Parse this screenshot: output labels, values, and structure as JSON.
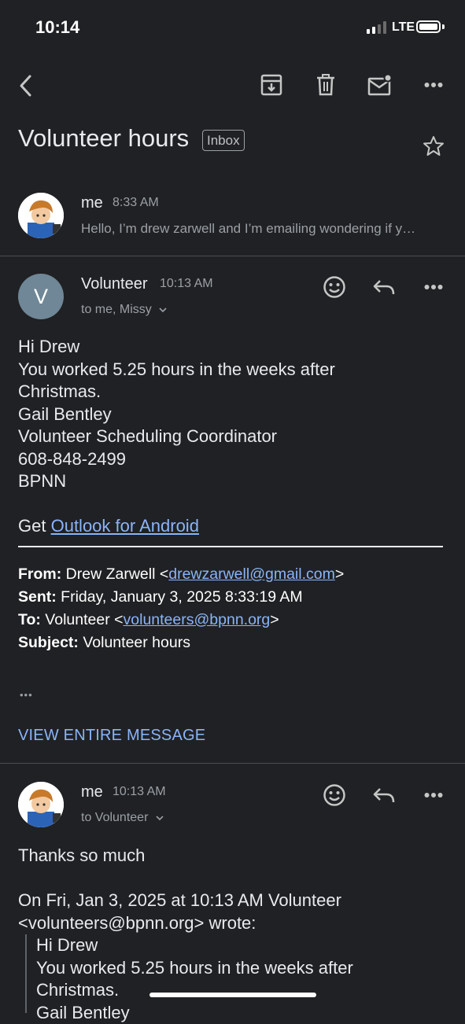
{
  "status_bar": {
    "time": "10:14",
    "network": "LTE",
    "signal_bars": 2,
    "icons": [
      "signal-icon",
      "battery-icon"
    ]
  },
  "toolbar": {
    "icons": [
      "back-arrow-icon",
      "archive-icon",
      "trash-icon",
      "mark-unread-icon",
      "more-icon"
    ]
  },
  "thread": {
    "subject": "Volunteer hours",
    "label": "Inbox"
  },
  "messages": [
    {
      "sender": "me",
      "time": "8:33 AM",
      "snippet": "Hello, I’m drew zarwell and I’m emailing wondering if y…"
    },
    {
      "sender": "Volunteer",
      "avatar_letter": "V",
      "time": "10:13 AM",
      "recipients": "to me, Missy",
      "body_lines": [
        "Hi Drew",
        "You worked 5.25 hours in the weeks after",
        "Christmas.",
        "Gail Bentley",
        "Volunteer Scheduling Coordinator",
        "608-848-2499",
        "BPNN"
      ],
      "signature_prefix": "Get",
      "signature_link": "Outlook for Android",
      "quoted_header": {
        "from_label": "From:",
        "from_name": "Drew Zarwell <",
        "from_email": "drewzarwell@gmail.com",
        "from_close": ">",
        "sent_label": "Sent:",
        "sent_value": "Friday, January 3, 2025 8:33:19 AM",
        "to_label": "To:",
        "to_name": "Volunteer <",
        "to_email": "volunteers@bpnn.org",
        "to_close": ">",
        "subject_label": "Subject:",
        "subject_value": "Volunteer hours"
      },
      "ellipsis": "•••",
      "view_entire": "VIEW ENTIRE MESSAGE"
    },
    {
      "sender": "me",
      "time": "10:13 AM",
      "recipients": "to Volunteer",
      "body": "Thanks so much",
      "quote_intro_1": "On Fri, Jan 3, 2025 at 10:13 AM Volunteer",
      "quote_intro_2": "<volunteers@bpnn.org> wrote:",
      "quoted_lines": [
        "Hi Drew",
        "You worked 5.25 hours in the weeks after",
        "Christmas.",
        "Gail Bentley"
      ]
    }
  ],
  "colors": {
    "background": "#202124",
    "link": "#8ab4f8",
    "avatar_v": "#6f8796"
  }
}
